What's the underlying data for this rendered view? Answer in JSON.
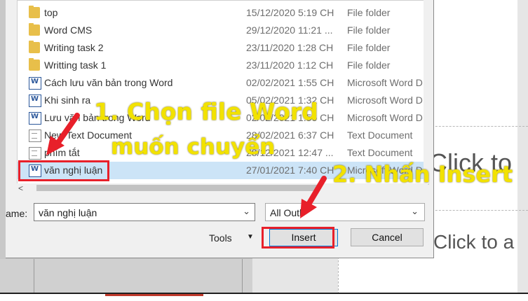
{
  "files": [
    {
      "name": "top",
      "date": "15/12/2020 5:19 CH",
      "type": "File folder",
      "icon": "folder-icon"
    },
    {
      "name": "Word CMS",
      "date": "29/12/2020 11:21 ...",
      "type": "File folder",
      "icon": "folder-icon"
    },
    {
      "name": "Writing task 2",
      "date": "23/11/2020 1:28 CH",
      "type": "File folder",
      "icon": "folder-icon"
    },
    {
      "name": "Writting task 1",
      "date": "23/11/2020 1:12 CH",
      "type": "File folder",
      "icon": "folder-icon"
    },
    {
      "name": "Cách lưu văn bản trong Word",
      "date": "02/02/2021 1:55 CH",
      "type": "Microsoft Word D",
      "icon": "word-document-icon"
    },
    {
      "name": "Khi sinh ra",
      "date": "05/02/2021 1:32 CH",
      "type": "Microsoft Word D",
      "icon": "word-document-icon"
    },
    {
      "name": "Lưu văn bản trong Word",
      "date": "02/02/2021 1:56 CH",
      "type": "Microsoft Word D",
      "icon": "word-document-icon"
    },
    {
      "name": "New Text Document",
      "date": "28/02/2021 6:37 CH",
      "type": "Text Document",
      "icon": "text-document-icon"
    },
    {
      "name": "phím tắt",
      "date": "28/12/2021 12:47 ...",
      "type": "Text Document",
      "icon": "text-document-icon"
    },
    {
      "name": "văn nghị luận",
      "date": "27/01/2021 7:40 CH",
      "type": "Microsoft Word D",
      "icon": "word-document-icon",
      "selected": true
    }
  ],
  "filename": {
    "label": "ame:",
    "value": "văn nghị luận"
  },
  "filter": {
    "value": "All Outl"
  },
  "buttons": {
    "tools": "Tools",
    "insert": "Insert",
    "cancel": "Cancel"
  },
  "slide": {
    "text1": "Click to",
    "text2": "Click to a"
  },
  "annotations": {
    "step1_line1": "1. Chọn file Word",
    "step1_line2": "muốn chuyển",
    "step2": "2. Nhấn Insert"
  },
  "colors": {
    "annotation_text": "#f2e200",
    "highlight_box": "#e8202a",
    "selection": "#cce4f7"
  }
}
